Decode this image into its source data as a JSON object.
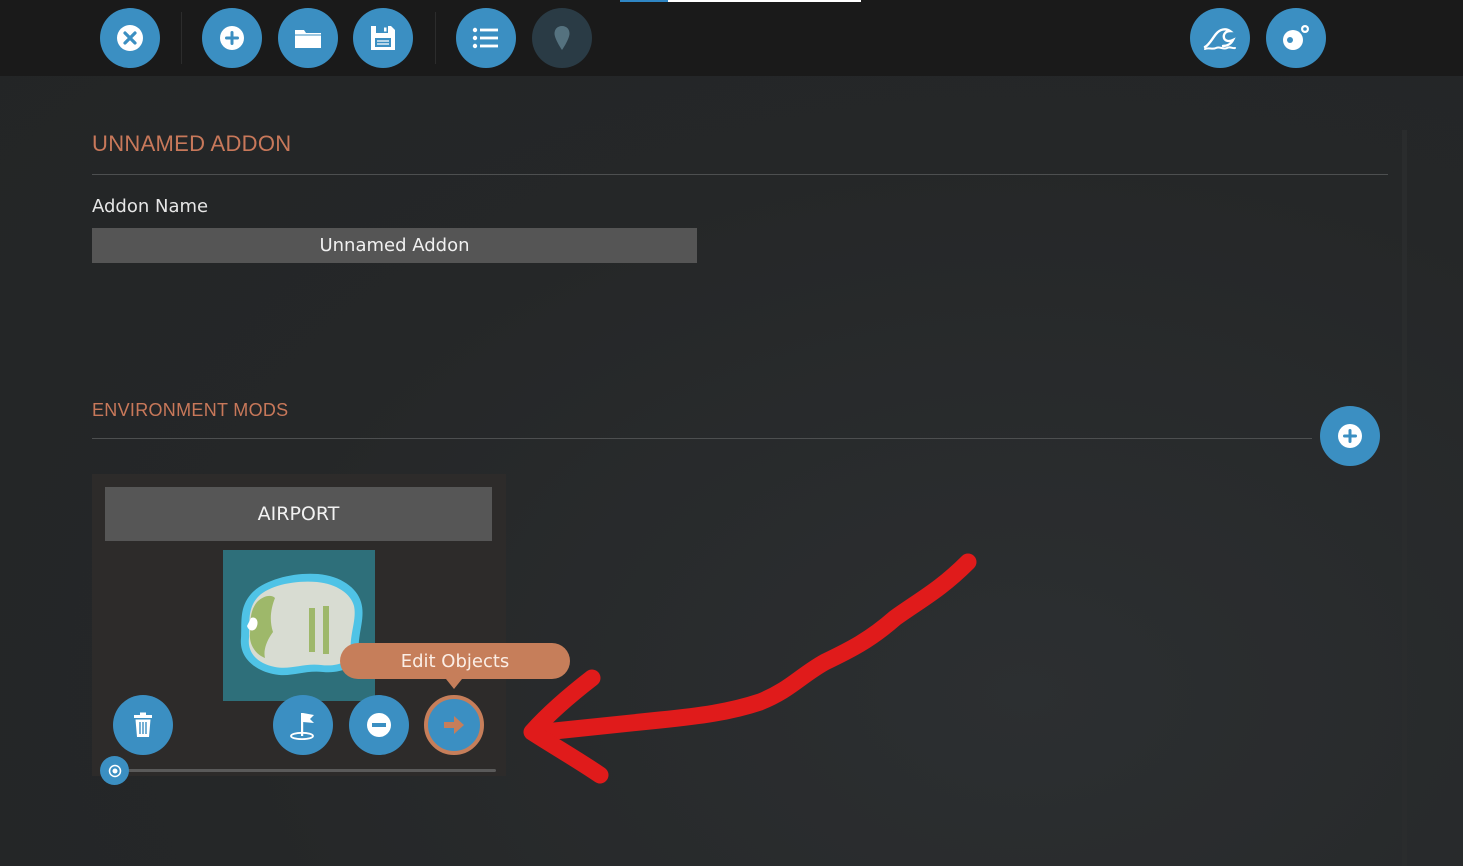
{
  "toolbar": {
    "buttons": [
      {
        "id": "close",
        "icon": "close-circle-icon"
      },
      {
        "id": "new",
        "icon": "plus-circle-icon"
      },
      {
        "id": "open",
        "icon": "folder-icon"
      },
      {
        "id": "save",
        "icon": "save-icon"
      },
      {
        "id": "list",
        "icon": "list-icon"
      },
      {
        "id": "location",
        "icon": "map-pin-icon",
        "disabled": true
      },
      {
        "id": "water",
        "icon": "wave-icon"
      },
      {
        "id": "toggle",
        "icon": "bubble-icon"
      }
    ],
    "progress": 0.2
  },
  "addon": {
    "title": "UNNAMED ADDON",
    "name_label": "Addon Name",
    "name_value": "Unnamed Addon"
  },
  "environment_mods": {
    "title": "ENVIRONMENT MODS",
    "add_icon": "plus-circle-icon",
    "items": [
      {
        "name": "AIRPORT",
        "thumbnail": "island-map",
        "buttons": [
          "trash-icon",
          "flag-icon",
          "minus-circle-icon",
          "arrow-right-icon"
        ],
        "tooltip": "Edit Objects"
      }
    ]
  },
  "colors": {
    "accent_blue": "#3b8fc2",
    "accent_orange": "#c8785a",
    "annotation_red": "#e01b1b",
    "background": "#262829",
    "toolbar": "#1a1a1a"
  }
}
